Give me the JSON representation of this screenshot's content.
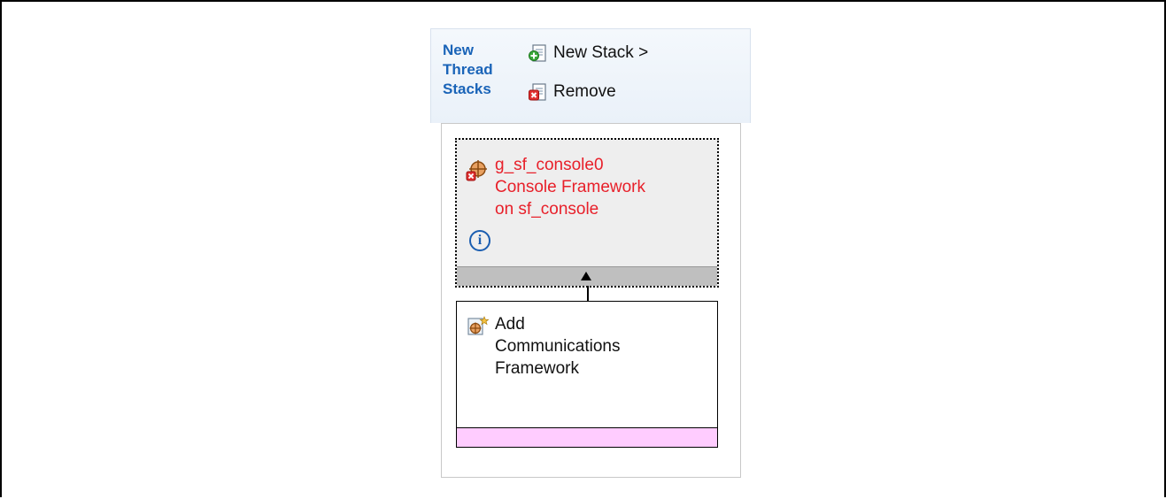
{
  "toolbar": {
    "title_lines": [
      "New",
      "Thread",
      "Stacks"
    ],
    "new_stack_label": "New Stack >",
    "remove_label": "Remove"
  },
  "module": {
    "lines": [
      "g_sf_console0",
      "Console Framework",
      "on sf_console"
    ],
    "info_glyph": "i",
    "text_color": "#e8202a"
  },
  "add_dependency": {
    "lines": [
      "Add",
      "Communications",
      "Framework"
    ],
    "color": "#ffccff"
  },
  "colors": {
    "title": "#1a64b8",
    "info": "#1a5db0"
  },
  "icons": {
    "new_stack": "new-stack-icon",
    "remove": "remove-icon",
    "module": "module-error-icon",
    "info": "info-icon",
    "add": "add-module-icon"
  }
}
